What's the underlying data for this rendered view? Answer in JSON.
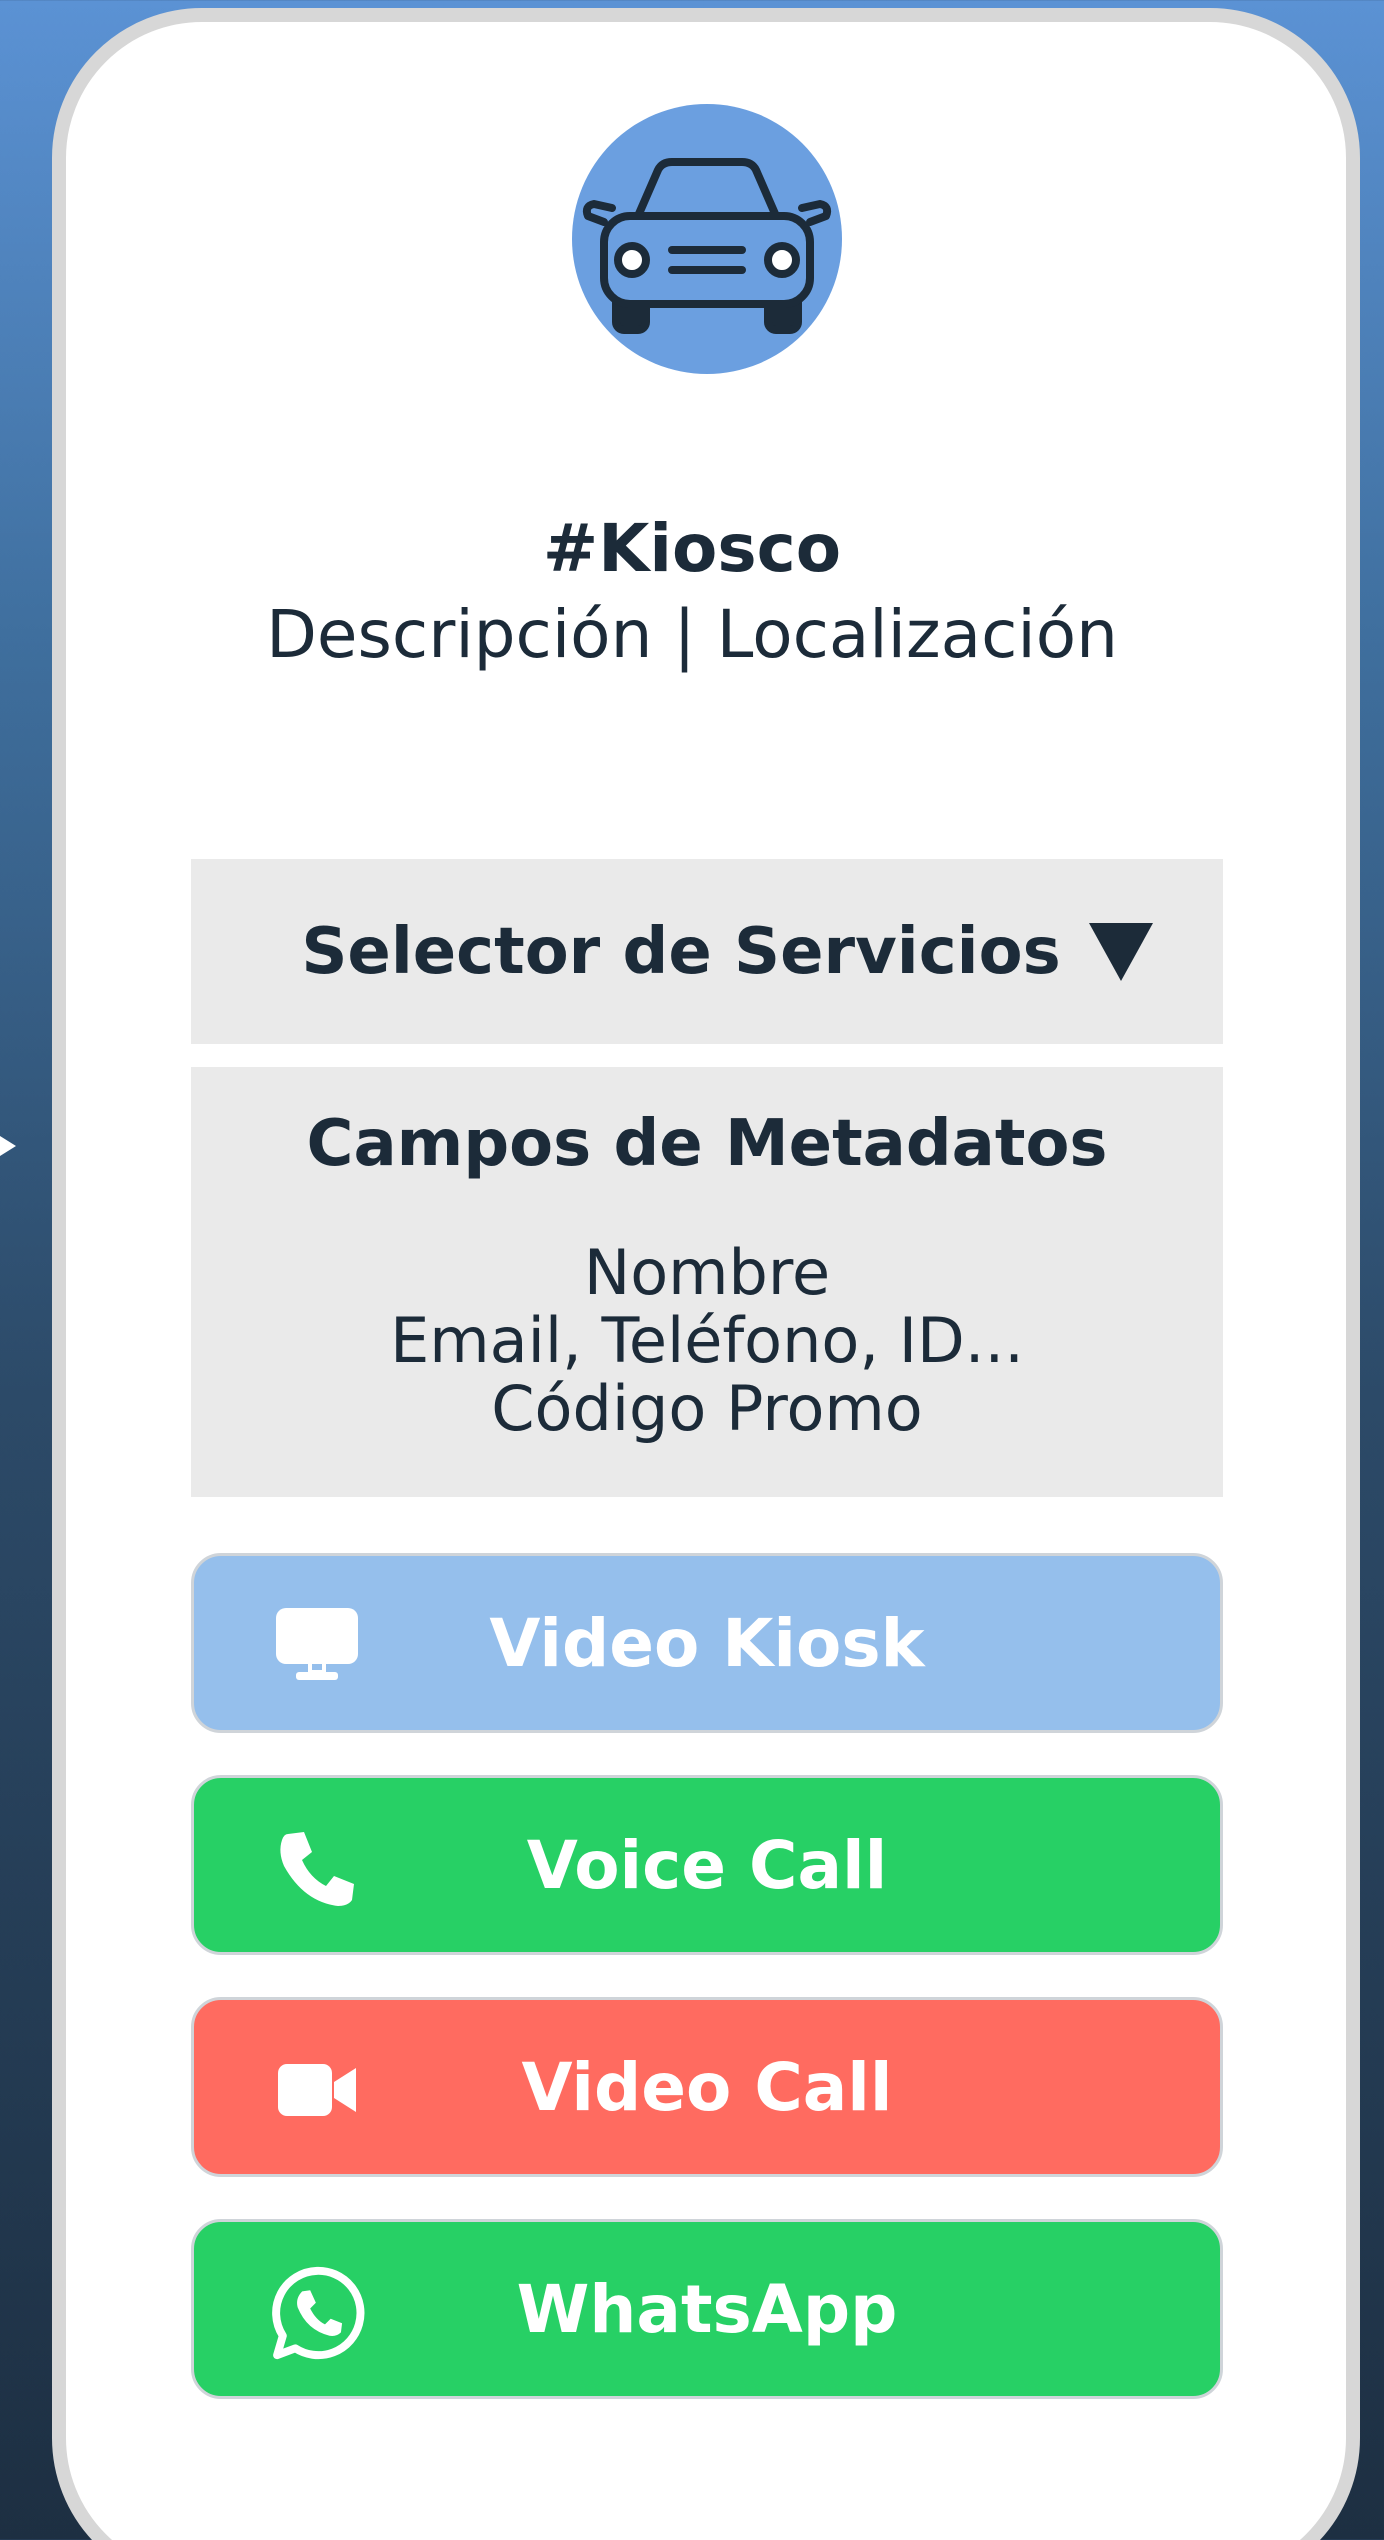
{
  "header": {
    "avatar_icon": "car-icon",
    "avatar_color": "#6b9fe0",
    "title": "#Kiosco",
    "subtitle": "Descripción | Localización"
  },
  "service_selector": {
    "label": "Selector de Servicios",
    "icon": "caret-down-icon"
  },
  "metadata": {
    "title": "Campos de Metadatos",
    "fields": [
      "Nombre",
      "Email, Teléfono, ID...",
      "Código Promo"
    ]
  },
  "actions": [
    {
      "label": "Video Kiosk",
      "icon": "monitor-icon",
      "color": "#95bfec"
    },
    {
      "label": "Voice Call",
      "icon": "phone-icon",
      "color": "#27d065"
    },
    {
      "label": "Video Call",
      "icon": "video-camera-icon",
      "color": "#ff6b60"
    },
    {
      "label": "WhatsApp",
      "icon": "whatsapp-icon",
      "color": "#27d065"
    }
  ]
}
